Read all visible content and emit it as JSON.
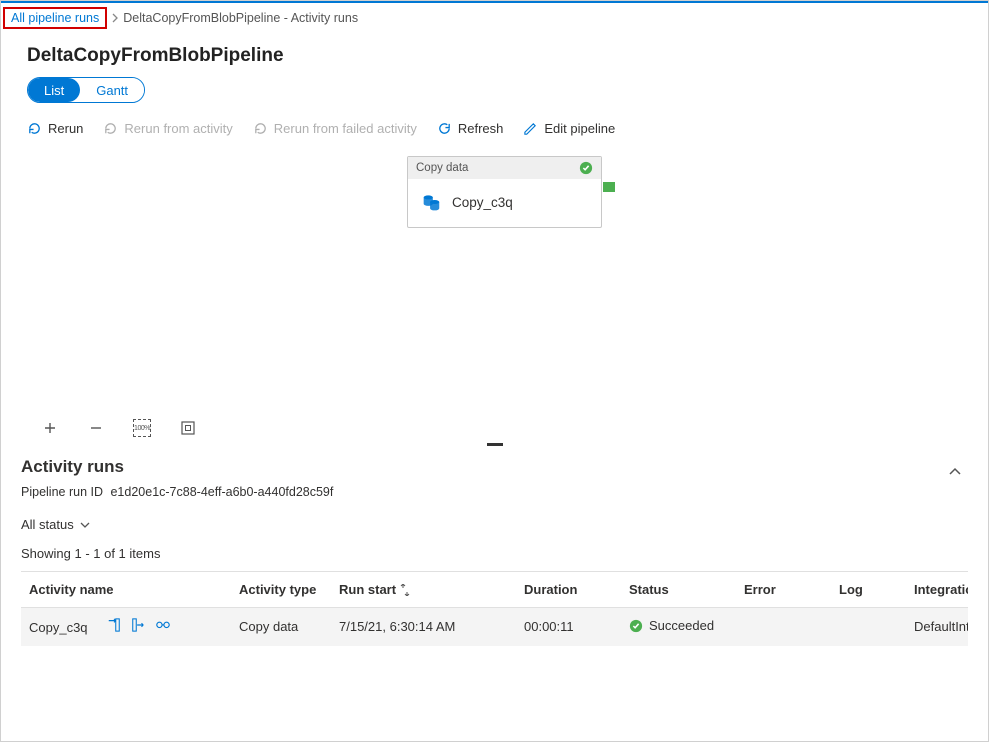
{
  "breadcrumb": {
    "root": "All pipeline runs",
    "current": "DeltaCopyFromBlobPipeline - Activity runs"
  },
  "page": {
    "title": "DeltaCopyFromBlobPipeline"
  },
  "viewToggle": {
    "list": "List",
    "gantt": "Gantt"
  },
  "toolbar": {
    "rerun": "Rerun",
    "rerun_activity": "Rerun from activity",
    "rerun_failed": "Rerun from failed activity",
    "refresh": "Refresh",
    "edit": "Edit pipeline"
  },
  "activityNode": {
    "typeLabel": "Copy data",
    "name": "Copy_c3q"
  },
  "canvasControls": {
    "zoom_level": "100%"
  },
  "activityRuns": {
    "heading": "Activity runs",
    "runIdLabel": "Pipeline run ID",
    "runId": "e1d20e1c-7c88-4eff-a6b0-a440fd28c59f",
    "filterLabel": "All status",
    "countText": "Showing 1 - 1 of 1 items",
    "columns": {
      "activity_name": "Activity name",
      "activity_type": "Activity type",
      "run_start": "Run start",
      "duration": "Duration",
      "status": "Status",
      "error": "Error",
      "log": "Log",
      "integration": "Integration r"
    },
    "rows": [
      {
        "name": "Copy_c3q",
        "type": "Copy data",
        "run_start": "7/15/21, 6:30:14 AM",
        "duration": "00:00:11",
        "status": "Succeeded",
        "error": "",
        "log": "",
        "integration": "DefaultIntegr"
      }
    ]
  }
}
